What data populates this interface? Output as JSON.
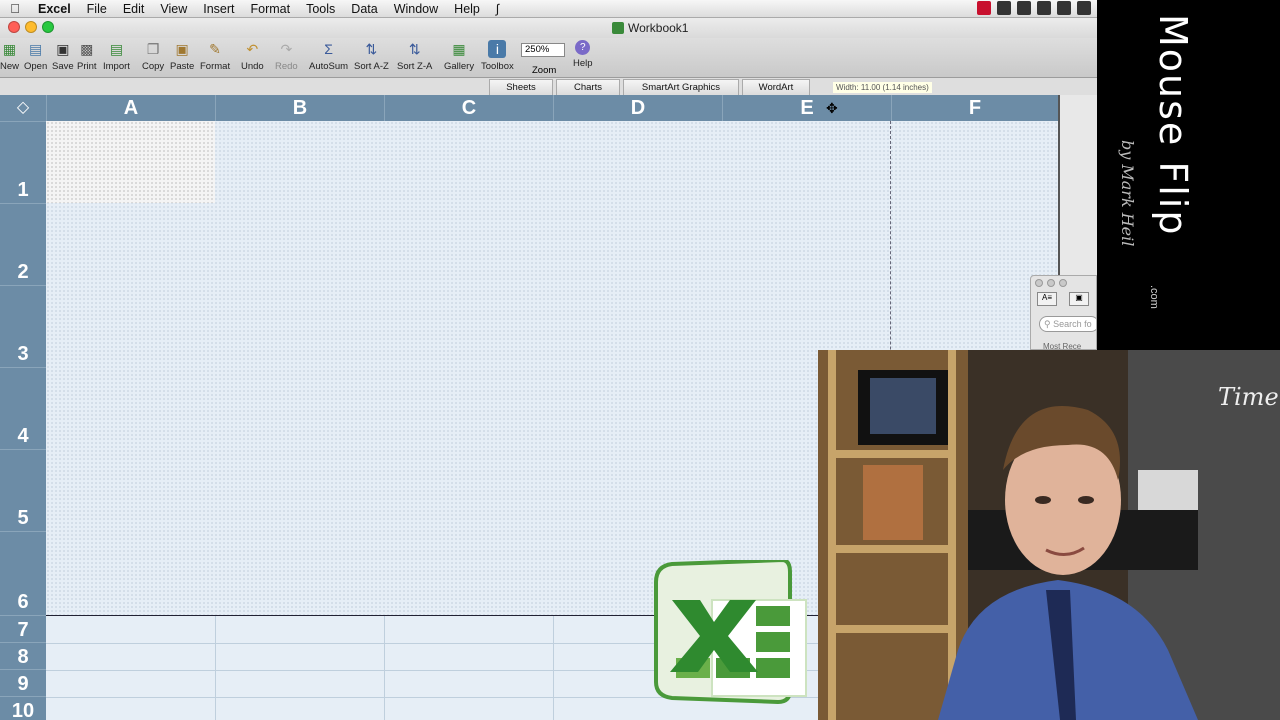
{
  "menubar": {
    "app": "Excel",
    "items": [
      "File",
      "Edit",
      "View",
      "Insert",
      "Format",
      "Tools",
      "Data",
      "Window",
      "Help"
    ]
  },
  "window": {
    "title": "Workbook1"
  },
  "toolbar": {
    "new": "New",
    "open": "Open",
    "save": "Save",
    "print": "Print",
    "import": "Import",
    "copy": "Copy",
    "paste": "Paste",
    "format": "Format",
    "undo": "Undo",
    "redo": "Redo",
    "autosum": "AutoSum",
    "sort_az": "Sort A-Z",
    "sort_za": "Sort Z-A",
    "gallery": "Gallery",
    "toolbox": "Toolbox",
    "zoom_value": "250%",
    "zoom": "Zoom",
    "help": "Help"
  },
  "ribbon_tabs": [
    "Sheets",
    "Charts",
    "SmartArt Graphics",
    "WordArt"
  ],
  "tooltip": "Width: 11.00 (1.14 inches)",
  "columns": [
    "A",
    "B",
    "C",
    "D",
    "E",
    "F"
  ],
  "rows": [
    "1",
    "2",
    "3",
    "4",
    "5",
    "6",
    "7",
    "8",
    "9",
    "10"
  ],
  "panel": {
    "search_placeholder": "Search fo",
    "recent": "Most Rece"
  },
  "branding": {
    "name": "Mouse Flip",
    "byline": "by Mark Heil",
    "domain": ".com"
  },
  "colors": {
    "header": "#6c8ca6",
    "grid": "#e6eef6",
    "excel_green": "#3a8a3a"
  }
}
